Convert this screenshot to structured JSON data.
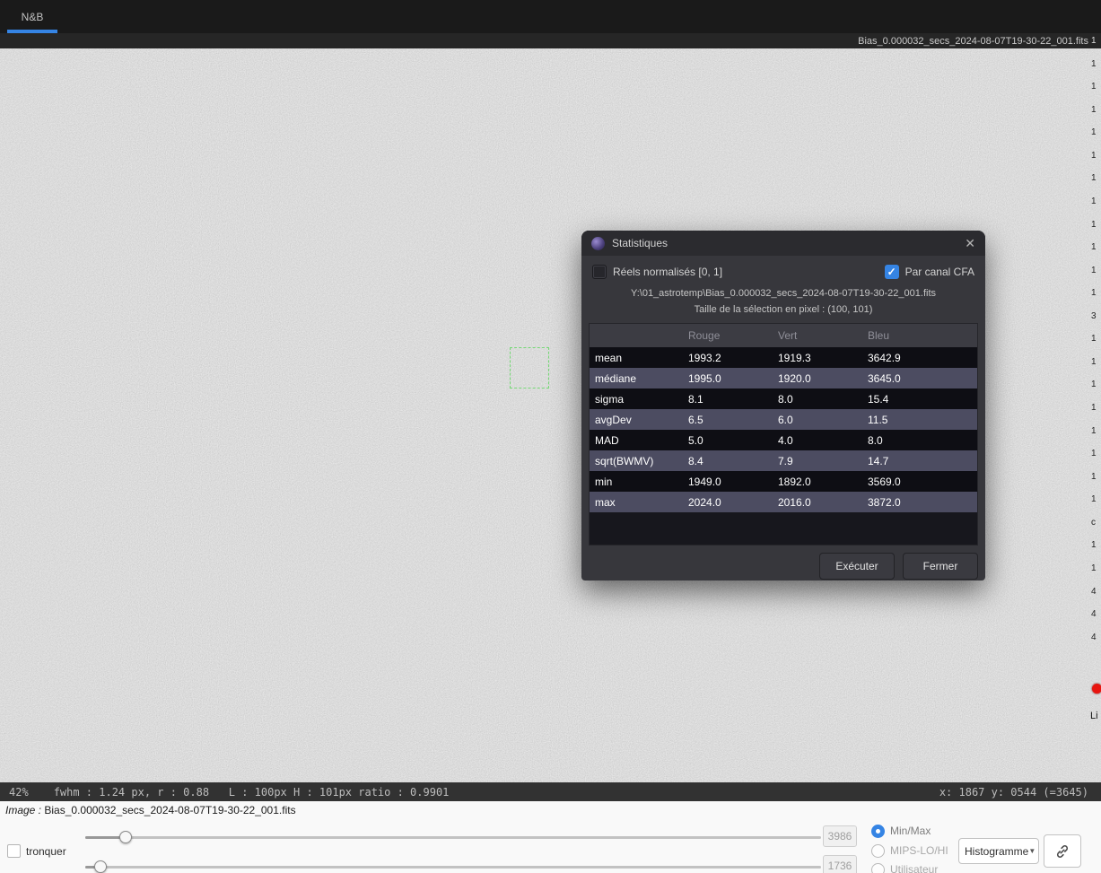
{
  "app": {
    "tab_label": "N&B",
    "titlebar_filename": "Bias_0.000032_secs_2024-08-07T19-30-22_001.fits"
  },
  "icons": {
    "close": "✕",
    "check": "✓",
    "dropdown_arrow": "▼"
  },
  "dialog": {
    "title": "Statistiques",
    "normalized_checkbox_label": "Réels normalisés [0, 1]",
    "cfa_checkbox_label": "Par canal CFA",
    "file_path": "Y:\\01_astrotemp\\Bias_0.000032_secs_2024-08-07T19-30-22_001.fits",
    "selection_size_text": "Taille de la sélection en pixel : (100, 101)",
    "table": {
      "headers": [
        "Rouge",
        "Vert",
        "Bleu"
      ],
      "rows": [
        {
          "label": "mean",
          "values": [
            "1993.2",
            "1919.3",
            "3642.9"
          ]
        },
        {
          "label": "médiane",
          "values": [
            "1995.0",
            "1920.0",
            "3645.0"
          ]
        },
        {
          "label": "sigma",
          "values": [
            "8.1",
            "8.0",
            "15.4"
          ]
        },
        {
          "label": "avgDev",
          "values": [
            "6.5",
            "6.0",
            "11.5"
          ]
        },
        {
          "label": "MAD",
          "values": [
            "5.0",
            "4.0",
            "8.0"
          ]
        },
        {
          "label": "sqrt(BWMV)",
          "values": [
            "8.4",
            "7.9",
            "14.7"
          ]
        },
        {
          "label": "min",
          "values": [
            "1949.0",
            "1892.0",
            "3569.0"
          ]
        },
        {
          "label": "max",
          "values": [
            "2024.0",
            "2016.0",
            "3872.0"
          ]
        }
      ]
    },
    "execute_button": "Exécuter",
    "close_button": "Fermer"
  },
  "statusbar": {
    "zoom": "42%",
    "measurements": "fwhm : 1.24 px, r : 0.88   L : 100px H : 101px ratio : 0.9901",
    "cursor": "x: 1867 y: 0544 (=3645)"
  },
  "bottom_panel": {
    "image_label": "Image :",
    "image_filename": "Bias_0.000032_secs_2024-08-07T19-30-22_001.fits",
    "truncate_label": "tronquer",
    "high_value": "3986",
    "low_value": "1736",
    "radios": [
      {
        "label": "Min/Max",
        "selected": true
      },
      {
        "label": "MIPS-LO/HI",
        "selected": false
      },
      {
        "label": "Utilisateur",
        "selected": false
      }
    ],
    "display_mode": "Histogramme"
  },
  "right_edge": {
    "glyphs": [
      "1",
      "1",
      "1",
      "1",
      "1",
      "1",
      "1",
      "1",
      "1",
      "1",
      "1",
      "1",
      "3",
      "1",
      "1",
      "1",
      "1",
      "1",
      "1",
      "1",
      "1",
      "c",
      "1",
      "1",
      "4",
      "4",
      "4"
    ],
    "partial_label": "Li"
  },
  "colors": {
    "accent_blue": "#3584e4",
    "selection_green": "#74d874",
    "row_dark": "#0e0e14",
    "row_light": "#4c4c61",
    "red_indicator": "#e8150f"
  }
}
